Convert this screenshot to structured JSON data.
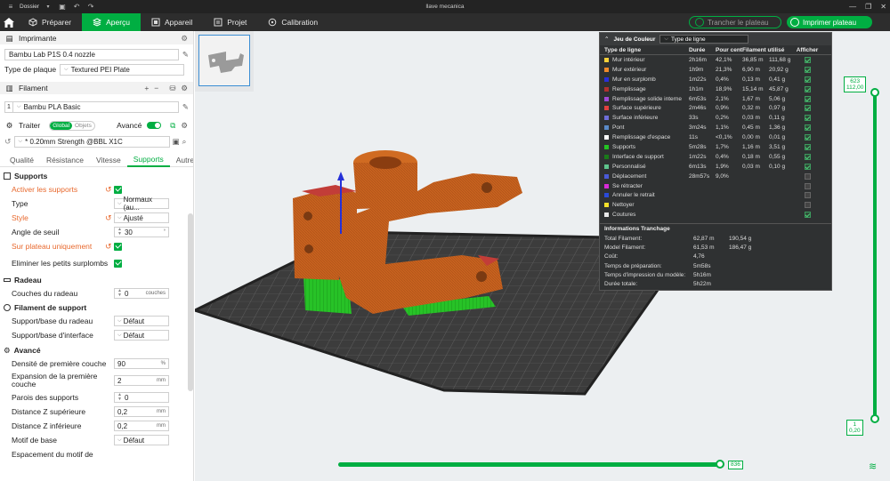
{
  "app": {
    "menu_label": "Dossier",
    "window_title": "llave mecanica"
  },
  "tabs": [
    {
      "label": "Préparer"
    },
    {
      "label": "Aperçu"
    },
    {
      "label": "Appareil"
    },
    {
      "label": "Projet"
    },
    {
      "label": "Calibration"
    }
  ],
  "actions": {
    "slice": "Trancher le plateau",
    "print": "Imprimer plateau"
  },
  "printer": {
    "section": "Imprimante",
    "name": "Bambu Lab P1S 0.4 nozzle",
    "plate_label": "Type de plaque",
    "plate_value": "Textured PEI Plate"
  },
  "filament": {
    "section": "Filament",
    "slot": "1",
    "name": "Bambu PLA Basic"
  },
  "process": {
    "section": "Traiter",
    "toggle_global": "Global",
    "toggle_objects": "Objets",
    "advanced": "Avancé",
    "preset": "* 0.20mm Strength @BBL X1C"
  },
  "settings_tabs": [
    "Qualité",
    "Résistance",
    "Vitesse",
    "Supports",
    "Autre"
  ],
  "groups": {
    "supports": {
      "title": "Supports",
      "enable": "Activer les supports",
      "type_label": "Type",
      "type_value": "Normaux (au...",
      "style_label": "Style",
      "style_value": "Ajusté",
      "angle_label": "Angle de seuil",
      "angle_value": "30",
      "angle_unit": "°",
      "build_plate_only": "Sur plateau uniquement",
      "remove_small": "Eliminer les petits surplombs"
    },
    "raft": {
      "title": "Radeau",
      "layers_label": "Couches du radeau",
      "layers_value": "0",
      "layers_unit": "couches"
    },
    "support_filament": {
      "title": "Filament de support",
      "base_label": "Support/base du radeau",
      "base_value": "Défaut",
      "interface_label": "Support/base d'interface",
      "interface_value": "Défaut"
    },
    "advanced": {
      "title": "Avancé",
      "first_layer_density_label": "Densité de première couche",
      "first_layer_density_value": "90",
      "first_layer_density_unit": "%",
      "first_layer_expansion_label": "Expansion de la première couche",
      "first_layer_expansion_value": "2",
      "first_layer_expansion_unit": "mm",
      "walls_label": "Parois des supports",
      "walls_value": "0",
      "top_z_label": "Distance Z supérieure",
      "top_z_value": "0,2",
      "top_z_unit": "mm",
      "bottom_z_label": "Distance Z inférieure",
      "bottom_z_value": "0,2",
      "bottom_z_unit": "mm",
      "pattern_label": "Motif de base",
      "pattern_value": "Défaut",
      "spacing_label": "Espacement du motif de"
    }
  },
  "legend": {
    "title": "Jeu de Couleur",
    "select_value": "Type de ligne",
    "columns": [
      "Type de ligne",
      "Durée",
      "Pour cent",
      "Filament utilisé",
      "Afficher"
    ],
    "rows": [
      {
        "name": "Mur intérieur",
        "color": "#f5d03a",
        "time": "2h16m",
        "pct": "42,1%",
        "len": "36,85 m",
        "weight": "111,68 g",
        "show": true
      },
      {
        "name": "Mur extérieur",
        "color": "#f08a2a",
        "time": "1h9m",
        "pct": "21,3%",
        "len": "6,90 m",
        "weight": "20,92 g",
        "show": true
      },
      {
        "name": "Mur en surplomb",
        "color": "#2a2fd8",
        "time": "1m22s",
        "pct": "0,4%",
        "len": "0,13 m",
        "weight": "0,41 g",
        "show": true
      },
      {
        "name": "Remplissage",
        "color": "#b1302e",
        "time": "1h1m",
        "pct": "18,9%",
        "len": "15,14 m",
        "weight": "45,87 g",
        "show": true
      },
      {
        "name": "Remplissage solide interne",
        "color": "#a04ad8",
        "time": "6m53s",
        "pct": "2,1%",
        "len": "1,67 m",
        "weight": "5,06 g",
        "show": true
      },
      {
        "name": "Surface supérieure",
        "color": "#e24040",
        "time": "2m46s",
        "pct": "0,9%",
        "len": "0,32 m",
        "weight": "0,97 g",
        "show": true
      },
      {
        "name": "Surface inférieure",
        "color": "#6e6ed8",
        "time": "33s",
        "pct": "0,2%",
        "len": "0,03 m",
        "weight": "0,11 g",
        "show": true
      },
      {
        "name": "Pont",
        "color": "#5a8ac8",
        "time": "3m24s",
        "pct": "1,1%",
        "len": "0,45 m",
        "weight": "1,36 g",
        "show": true
      },
      {
        "name": "Remplissage d'espace",
        "color": "#ffffff",
        "time": "11s",
        "pct": "<0,1%",
        "len": "0,00 m",
        "weight": "0,01 g",
        "show": true
      },
      {
        "name": "Supports",
        "color": "#24c424",
        "time": "5m28s",
        "pct": "1,7%",
        "len": "1,16 m",
        "weight": "3,51 g",
        "show": true
      },
      {
        "name": "Interface de support",
        "color": "#1a7a1a",
        "time": "1m22s",
        "pct": "0,4%",
        "len": "0,18 m",
        "weight": "0,55 g",
        "show": true
      },
      {
        "name": "Personnalisé",
        "color": "#5ec48c",
        "time": "6m13s",
        "pct": "1,9%",
        "len": "0,03 m",
        "weight": "0,10 g",
        "show": true
      },
      {
        "name": "Déplacement",
        "color": "#4a5ad8",
        "time": "28m57s",
        "pct": "9,0%",
        "len": "",
        "weight": "",
        "show": false
      },
      {
        "name": "Se rétracter",
        "color": "#d82ad8",
        "time": "",
        "pct": "",
        "len": "",
        "weight": "",
        "show": false
      },
      {
        "name": "Annuler le retrait",
        "color": "#2a4ad8",
        "time": "",
        "pct": "",
        "len": "",
        "weight": "",
        "show": false
      },
      {
        "name": "Nettoyer",
        "color": "#f5e02a",
        "time": "",
        "pct": "",
        "len": "",
        "weight": "",
        "show": false
      },
      {
        "name": "Coutures",
        "color": "#e8e8e8",
        "time": "",
        "pct": "",
        "len": "",
        "weight": "",
        "show": true
      }
    ],
    "info_title": "Informations Tranchage",
    "info": [
      {
        "k": "Total Filament:",
        "v1": "62,87 m",
        "v2": "190,54 g"
      },
      {
        "k": "Model Filament:",
        "v1": "61,53 m",
        "v2": "186,47 g"
      },
      {
        "k": "Coût:",
        "v1": "4,76",
        "v2": ""
      },
      {
        "k": "Temps de préparation:",
        "v1": "5m58s",
        "v2": ""
      },
      {
        "k": "Temps d'impression du modèle:",
        "v1": "5h16m",
        "v2": ""
      },
      {
        "k": "Durée totale:",
        "v1": "5h22m",
        "v2": ""
      }
    ]
  },
  "layer_slider": {
    "top_layer": "623",
    "top_height": "112,00",
    "bottom_layer": "1",
    "bottom_height": "0,20"
  },
  "move_slider": {
    "value": "836"
  }
}
